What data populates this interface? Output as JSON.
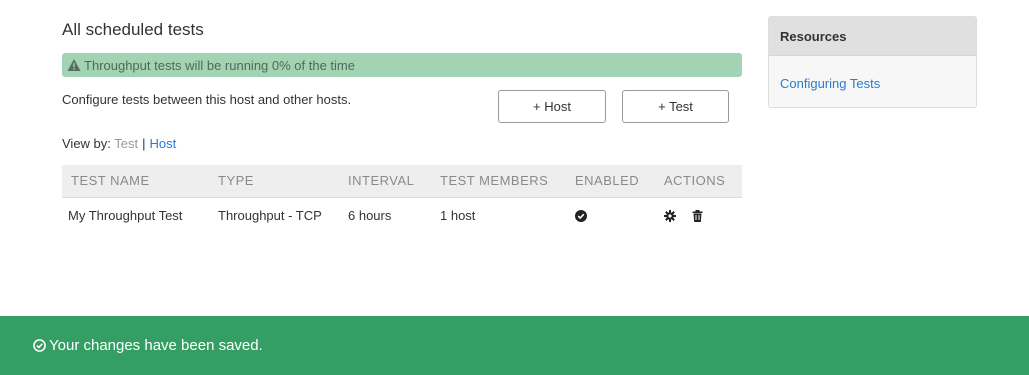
{
  "main": {
    "title": "All scheduled tests",
    "alert": {
      "text": "Throughput tests will be running 0% of the time",
      "icon": "warning-icon",
      "color": "#a3d3b5"
    },
    "description": "Configure tests between this host and other hosts.",
    "buttons": {
      "add_host": "+ Host",
      "add_test": "+ Test"
    },
    "view_by": {
      "label": "View by:",
      "options": [
        "Test",
        "Host"
      ],
      "active": "Test"
    }
  },
  "table": {
    "headers": [
      "TEST NAME",
      "TYPE",
      "INTERVAL",
      "TEST MEMBERS",
      "ENABLED",
      "ACTIONS"
    ],
    "rows": [
      {
        "name": "My Throughput Test",
        "type": "Throughput - TCP",
        "interval": "6 hours",
        "members": "1 host",
        "enabled_icon": "check-circle-icon",
        "actions": [
          "gear-icon",
          "trash-icon"
        ]
      }
    ]
  },
  "sidebar": {
    "heading": "Resources",
    "link": "Configuring Tests"
  },
  "footer": {
    "message": "Your changes have been saved.",
    "icon": "check-circle-icon",
    "color": "#349e64"
  }
}
